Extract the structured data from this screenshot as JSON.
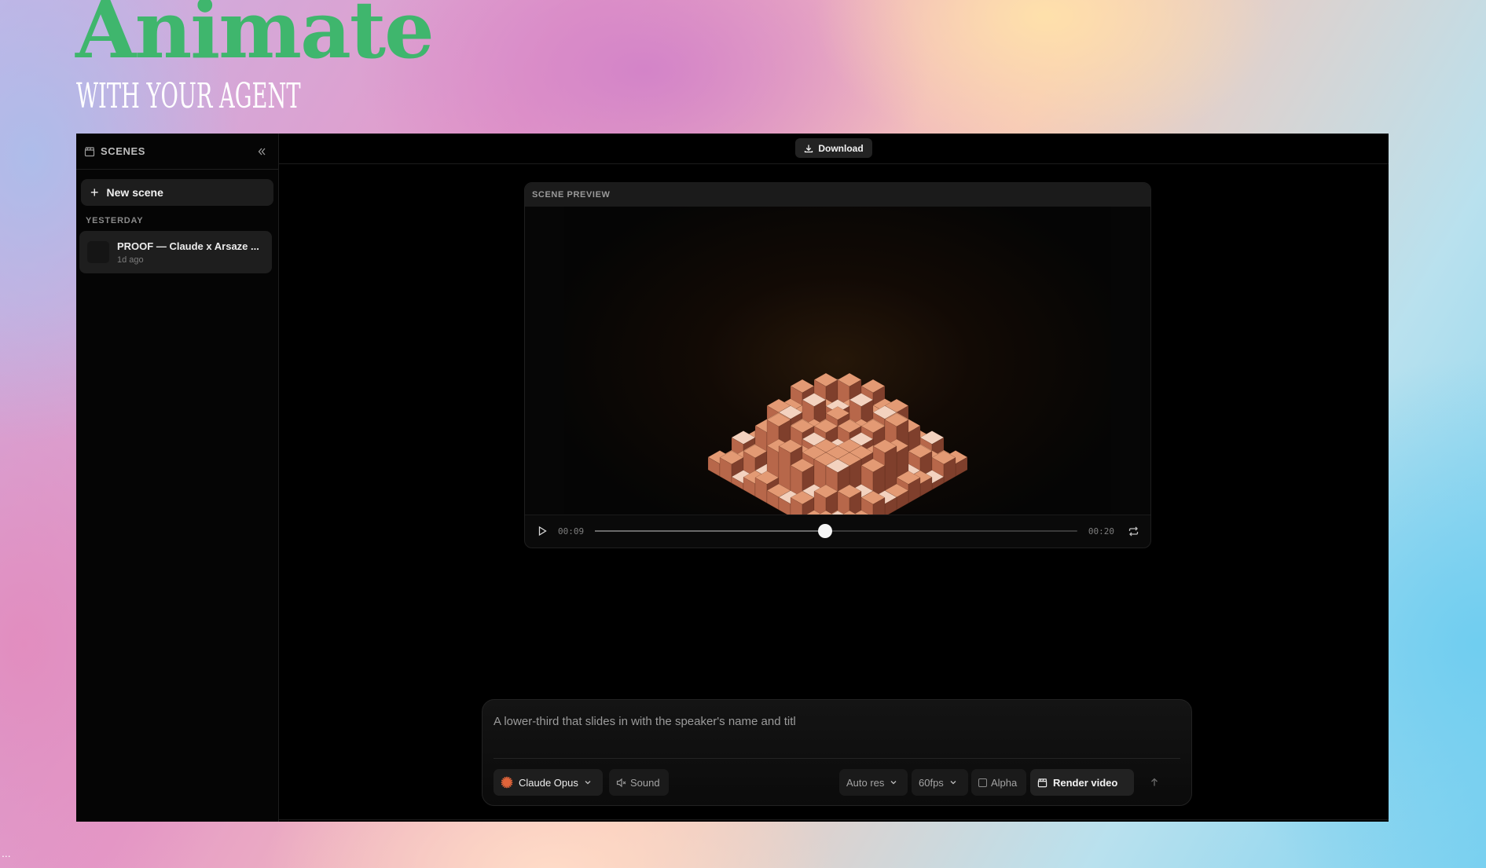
{
  "brand": {
    "title": "Animate",
    "subtitle": "WITH YOUR AGENT",
    "title_color": "#3fb66d"
  },
  "corner_text": "...",
  "sidebar": {
    "header_icon": "clapperboard-icon",
    "title": "SCENES",
    "collapse_icon": "chevrons-left-icon",
    "new_scene_label": "New scene",
    "new_scene_icon": "plus-icon",
    "groups": [
      {
        "label": "YESTERDAY",
        "items": [
          {
            "name": "PROOF — Claude x Arsaze ...",
            "time": "1d ago"
          }
        ]
      }
    ]
  },
  "topbar": {
    "download_label": "Download",
    "download_icon": "download-icon"
  },
  "preview": {
    "header": "SCENE PREVIEW",
    "time_current": "00:09",
    "time_total": "00:20",
    "progress": 0.478,
    "play_icon": "play-icon",
    "loop_icon": "repeat-icon",
    "accent": "#c9784f"
  },
  "composer": {
    "prompt_value": "A lower-third that slides in with the speaker's name and titl",
    "model_label": "Claude Opus",
    "model_icon": "claude-burst-icon",
    "model_icon_color": "#e0643a",
    "sound_label": "Sound",
    "sound_icon": "speaker-muted-icon",
    "resolution_label": "Auto res",
    "fps_label": "60fps",
    "alpha_label": "Alpha",
    "alpha_checked": false,
    "render_label": "Render video",
    "render_icon": "clapperboard-icon",
    "send_icon": "arrow-up-icon"
  }
}
